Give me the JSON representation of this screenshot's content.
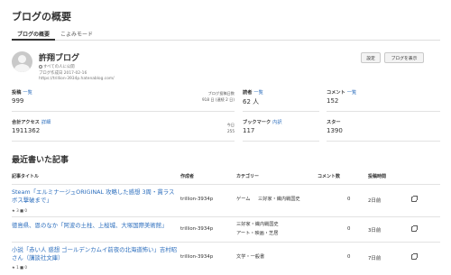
{
  "page_title": "ブログの概要",
  "tabs": [
    "ブログの概要",
    "こよみモード"
  ],
  "blog": {
    "name": "許翔ブログ",
    "visibility": "すべての人に公開",
    "created": "ブログ作成日 2017-02-16",
    "url": "https://trillion-3934p.hatenablog.com/"
  },
  "buttons": {
    "settings": "設定",
    "view_blog": "ブログを表示"
  },
  "stats": {
    "posts": {
      "label": "投稿",
      "link": "一覧",
      "value": "999",
      "period_label": "ブログ投稿日数",
      "period_value": "918 日 (連続 2 日)"
    },
    "readers": {
      "label": "読者",
      "link": "一覧",
      "value": "62 人"
    },
    "comments": {
      "label": "コメント",
      "link": "一覧",
      "value": "152"
    },
    "access": {
      "label": "合計アクセス",
      "link": "詳細",
      "value": "1911362",
      "today_label": "今日",
      "today_value": "255"
    },
    "bookmarks": {
      "label": "ブックマーク",
      "link": "内訳",
      "value": "117"
    },
    "stars": {
      "label": "スター",
      "value": "1390"
    }
  },
  "recent": {
    "title": "最近書いた記事",
    "headers": [
      "記事タイトル",
      "作成者",
      "カテゴリー",
      "コメント数",
      "投稿時間"
    ],
    "rows": [
      {
        "title": "Steam「エルミナージュORIGINAL 攻略した感想 3周・貫ラスボス撃破まで」",
        "meta": "★ 3   ■ 0",
        "author": "trillion-3934p",
        "categories": [
          "ゲーム",
          "三好家・織内戦国史"
        ],
        "comments": "0",
        "time": "2日前"
      },
      {
        "title": "徳島県、恩のなか「阿波の土柱、上桜城、大塚国際美術館」",
        "meta": "",
        "author": "trillion-3934p",
        "categories": [
          "三好家・織内戦国史",
          "アート・映画・芝居"
        ],
        "comments": "0",
        "time": "3日前"
      },
      {
        "title": "小説「赤い人 惑想 ゴールデンカムイ前夜の北海道怖い」吉村昭さん（講談社文庫）",
        "meta": "★ 1   ■ 0",
        "author": "trillion-3934p",
        "categories": [
          "文学・一般書"
        ],
        "comments": "0",
        "time": "7日前"
      }
    ]
  }
}
